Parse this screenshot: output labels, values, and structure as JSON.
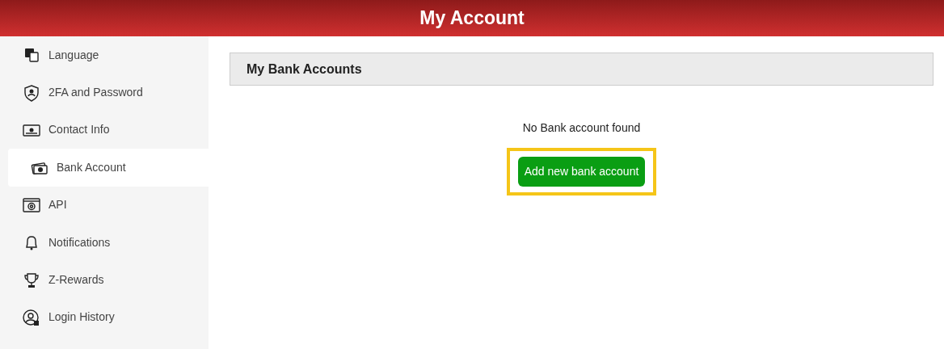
{
  "header": {
    "title": "My Account"
  },
  "sidebar": {
    "items": [
      {
        "label": "Language",
        "selected": false
      },
      {
        "label": "2FA and Password",
        "selected": false
      },
      {
        "label": "Contact Info",
        "selected": false
      },
      {
        "label": "Bank Account",
        "selected": true
      },
      {
        "label": "API",
        "selected": false
      },
      {
        "label": "Notifications",
        "selected": false
      },
      {
        "label": "Z-Rewards",
        "selected": false
      },
      {
        "label": "Login History",
        "selected": false
      }
    ]
  },
  "panel": {
    "title": "My Bank Accounts",
    "empty_message": "No Bank account found",
    "button": {
      "label": "Add new bank account",
      "highlighted": true
    }
  }
}
